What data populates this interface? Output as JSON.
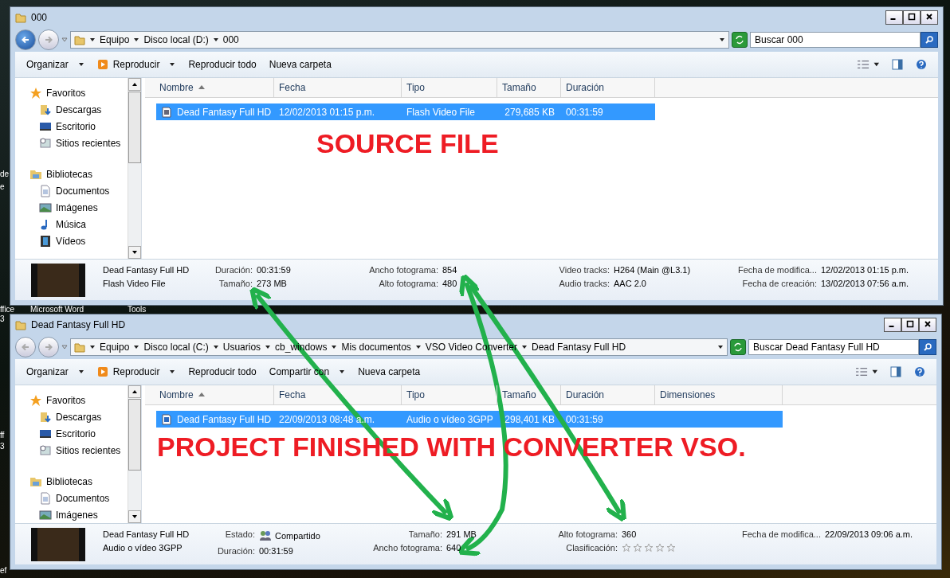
{
  "desktop_labels": [
    "de",
    "e",
    "ffice",
    "Microsoft Word",
    "Tools",
    "3",
    "ff",
    "3",
    "ef"
  ],
  "windows": [
    {
      "title": "000",
      "breadcrumbs": [
        "Equipo",
        "Disco local (D:)",
        "000"
      ],
      "back_enabled": true,
      "search": {
        "placeholder": "Buscar 000"
      },
      "toolbar": [
        {
          "label": "Organizar",
          "kind": "menu"
        },
        {
          "label": "Reproducir",
          "kind": "play"
        },
        {
          "label": "Reproducir todo",
          "kind": "plain"
        },
        {
          "label": "Nueva carpeta",
          "kind": "plain"
        }
      ],
      "nav": [
        {
          "label": "Favoritos",
          "children": [
            {
              "label": "Descargas"
            },
            {
              "label": "Escritorio"
            },
            {
              "label": "Sitios recientes"
            }
          ]
        },
        {
          "label": "Bibliotecas",
          "children": [
            {
              "label": "Documentos"
            },
            {
              "label": "Imágenes"
            },
            {
              "label": "Música"
            },
            {
              "label": "Vídeos"
            }
          ]
        }
      ],
      "columns": [
        {
          "label": "Nombre",
          "sorted": true
        },
        {
          "label": "Fecha",
          "sorted": false
        },
        {
          "label": "Tipo",
          "sorted": false
        },
        {
          "label": "Tamaño",
          "sorted": false
        },
        {
          "label": "Duración",
          "sorted": false
        }
      ],
      "rows": [
        {
          "selected": true,
          "cells": [
            "Dead Fantasy Full HD",
            "12/02/2013 01:15 p.m.",
            "Flash Video File",
            "279,685 KB",
            "00:31:59"
          ]
        }
      ],
      "details": {
        "name": "Dead Fantasy Full HD",
        "type": "Flash Video File",
        "columns": [
          [
            {
              "label": "Duración:",
              "value": "00:31:59",
              "kind": "text"
            },
            {
              "label": "Tamaño:",
              "value": "273 MB",
              "kind": "text"
            }
          ],
          [
            {
              "label": "Ancho fotograma:",
              "value": "854",
              "kind": "text"
            },
            {
              "label": "Alto fotograma:",
              "value": "480",
              "kind": "text"
            }
          ],
          [
            {
              "label": "Video tracks:",
              "value": "H264 (Main @L3.1)",
              "kind": "text"
            },
            {
              "label": "Audio tracks:",
              "value": "AAC 2.0",
              "kind": "text"
            }
          ],
          [
            {
              "label": "Fecha de modifica...",
              "value": "12/02/2013 01:15 p.m.",
              "kind": "text"
            },
            {
              "label": "Fecha de creación:",
              "value": "13/02/2013 07:56 a.m.",
              "kind": "text"
            }
          ]
        ]
      },
      "annotation": "SOURCE FILE"
    },
    {
      "title": "Dead Fantasy Full HD",
      "breadcrumbs": [
        "Equipo",
        "Disco local (C:)",
        "Usuarios",
        "cb_windows",
        "Mis documentos",
        "VSO Video Converter",
        "Dead Fantasy Full HD"
      ],
      "back_enabled": false,
      "search": {
        "placeholder": "Buscar Dead Fantasy Full HD"
      },
      "toolbar": [
        {
          "label": "Organizar",
          "kind": "menu"
        },
        {
          "label": "Reproducir",
          "kind": "play"
        },
        {
          "label": "Reproducir todo",
          "kind": "plain"
        },
        {
          "label": "Compartir con",
          "kind": "menu"
        },
        {
          "label": "Nueva carpeta",
          "kind": "plain"
        }
      ],
      "nav": [
        {
          "label": "Favoritos",
          "children": [
            {
              "label": "Descargas"
            },
            {
              "label": "Escritorio"
            },
            {
              "label": "Sitios recientes"
            }
          ]
        },
        {
          "label": "Bibliotecas",
          "children": [
            {
              "label": "Documentos"
            },
            {
              "label": "Imágenes"
            }
          ]
        }
      ],
      "columns": [
        {
          "label": "Nombre",
          "sorted": true
        },
        {
          "label": "Fecha",
          "sorted": false
        },
        {
          "label": "Tipo",
          "sorted": false
        },
        {
          "label": "Tamaño",
          "sorted": false
        },
        {
          "label": "Duración",
          "sorted": false
        },
        {
          "label": "Dimensiones",
          "sorted": false
        }
      ],
      "rows": [
        {
          "selected": true,
          "cells": [
            "Dead Fantasy Full HD",
            "22/09/2013 08:48 a.m.",
            "Audio o vídeo 3GPP",
            "298,401 KB",
            "00:31:59",
            ""
          ]
        }
      ],
      "details": {
        "name": "Dead Fantasy Full HD",
        "type": "Audio o vídeo 3GPP",
        "columns": [
          [
            {
              "label": "Estado:",
              "value": "Compartido",
              "kind": "shared"
            },
            {
              "label": "Duración:",
              "value": "00:31:59",
              "kind": "text"
            }
          ],
          [
            {
              "label": "Tamaño:",
              "value": "291 MB",
              "kind": "text"
            },
            {
              "label": "Ancho fotograma:",
              "value": "640",
              "kind": "text"
            }
          ],
          [
            {
              "label": "Alto fotograma:",
              "value": "360",
              "kind": "text"
            },
            {
              "label": "Clasificación:",
              "stars": 0,
              "kind": "rating"
            }
          ],
          [
            {
              "label": "Fecha de modifica...",
              "value": "22/09/2013 09:06 a.m.",
              "kind": "text"
            }
          ]
        ]
      },
      "annotation": "PROJECT FINISHED WITH CONVERTER VSO."
    }
  ]
}
